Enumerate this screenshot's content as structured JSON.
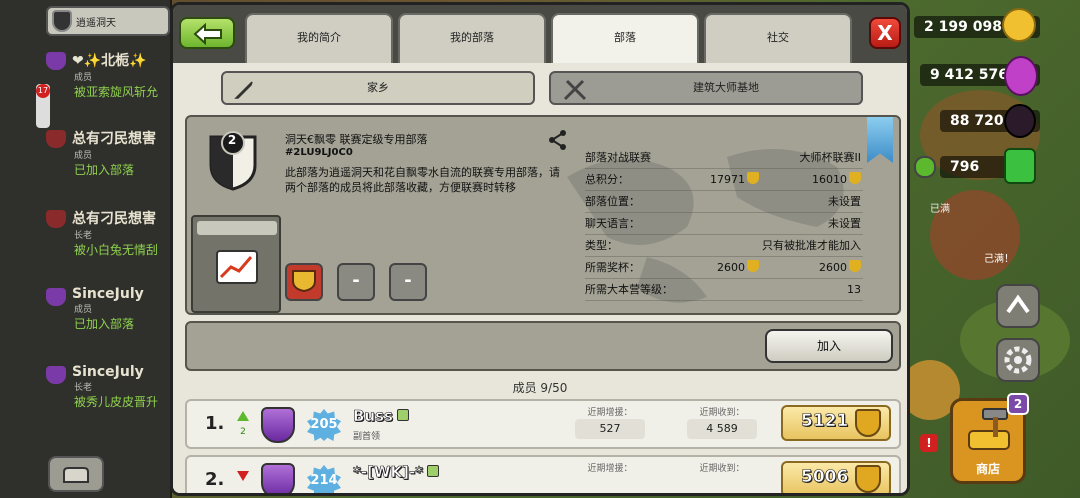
{
  "chat": {
    "clan_name": "逍遥洞天",
    "unread": "17",
    "messages": [
      {
        "name": "❤✨北栀✨",
        "role": "成员",
        "text": "被亚索旋风斩允"
      },
      {
        "name": "总有刁民想害",
        "role": "成员",
        "text": "已加入部落"
      },
      {
        "name": "总有刁民想害",
        "role": "长老",
        "text": "被小白兔无情刮"
      },
      {
        "name": "SinceJuly",
        "role": "成员",
        "text": "已加入部落"
      },
      {
        "name": "SinceJuly",
        "role": "长老",
        "text": "被秀儿皮皮晋升"
      }
    ]
  },
  "hud": {
    "gold": "2 199 098",
    "elixir": "9 412 576",
    "dark_elixir": "88 720",
    "gems": "796",
    "shop_label": "商店",
    "shop_badge": "2",
    "alert": "!",
    "fragment_1": "己满！",
    "fragment_2": "已满"
  },
  "tabs": {
    "profile": "我的简介",
    "my_clan": "我的部落",
    "clan": "部落",
    "social": "社交"
  },
  "close_label": "X",
  "subtabs": {
    "home": "家乡",
    "builder": "建筑大师基地"
  },
  "clan": {
    "level": "2",
    "name": "洞天€飘零 联赛定级专用部落",
    "tag": "#2LU9LJ0C0",
    "description": "此部落为逍遥洞天和花自飘零水自流的联赛专用部落，请两个部落的成员将此部落收藏，方便联赛时转移",
    "league_slots": [
      "",
      "-",
      "-"
    ],
    "info": [
      {
        "key": "部落对战联赛",
        "value": "大师杯联赛II"
      },
      {
        "key": "总积分：",
        "value1": "17971",
        "value": "16010",
        "trophy": true
      },
      {
        "key": "部落位置：",
        "value": "未设置"
      },
      {
        "key": "聊天语言：",
        "value": "未设置"
      },
      {
        "key": "类型：",
        "value": "只有被批准才能加入"
      },
      {
        "key": "所需奖杯：",
        "value1": "2600",
        "value": "2600",
        "trophy": true
      },
      {
        "key": "所需大本营等级：",
        "value": "13"
      }
    ],
    "join_label": "加入"
  },
  "members": {
    "title": "成员 9/50",
    "recent_donated_label": "近期增援：",
    "recent_received_label": "近期收到：",
    "rows": [
      {
        "rank": "1.",
        "direction": "up",
        "delta": "2",
        "xp": "205",
        "name": "Buss",
        "role": "副首领",
        "donated": "527",
        "received": "4 589",
        "trophies": "5121"
      },
      {
        "rank": "2.",
        "direction": "down",
        "delta": "",
        "xp": "214",
        "name": "*-[WK]-*",
        "role": "",
        "donated": "",
        "received": "",
        "trophies": "5006"
      }
    ]
  },
  "colors": {
    "accent_green": "#6eb52e",
    "close_red": "#d02020",
    "panel": "#a4a295",
    "trophy_gold": "#e0b020"
  }
}
